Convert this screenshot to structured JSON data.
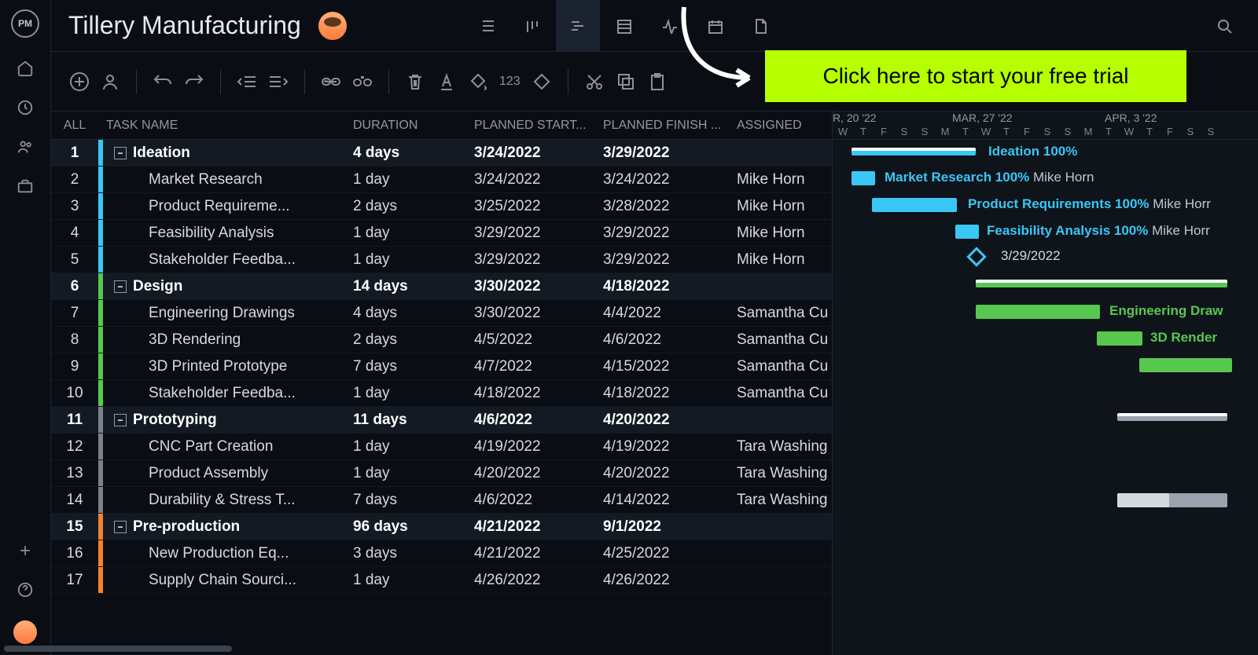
{
  "app": {
    "logo": "PM",
    "project_title": "Tillery Manufacturing"
  },
  "cta": {
    "label": "Click here to start your free trial"
  },
  "columns": {
    "all": "ALL",
    "name": "TASK NAME",
    "duration": "DURATION",
    "start": "PLANNED START...",
    "end": "PLANNED FINISH ...",
    "assigned": "ASSIGNED"
  },
  "toolbar_number": "123",
  "rows": [
    {
      "n": "1",
      "type": "parent",
      "color": "cyan",
      "name": "Ideation",
      "dur": "4 days",
      "s": "3/24/2022",
      "e": "3/29/2022",
      "a": ""
    },
    {
      "n": "2",
      "type": "child",
      "color": "cyan",
      "name": "Market Research",
      "dur": "1 day",
      "s": "3/24/2022",
      "e": "3/24/2022",
      "a": "Mike Horn"
    },
    {
      "n": "3",
      "type": "child",
      "color": "cyan",
      "name": "Product Requireme...",
      "dur": "2 days",
      "s": "3/25/2022",
      "e": "3/28/2022",
      "a": "Mike Horn"
    },
    {
      "n": "4",
      "type": "child",
      "color": "cyan",
      "name": "Feasibility Analysis",
      "dur": "1 day",
      "s": "3/29/2022",
      "e": "3/29/2022",
      "a": "Mike Horn"
    },
    {
      "n": "5",
      "type": "child",
      "color": "cyan",
      "name": "Stakeholder Feedba...",
      "dur": "1 day",
      "s": "3/29/2022",
      "e": "3/29/2022",
      "a": "Mike Horn"
    },
    {
      "n": "6",
      "type": "parent",
      "color": "green",
      "name": "Design",
      "dur": "14 days",
      "s": "3/30/2022",
      "e": "4/18/2022",
      "a": ""
    },
    {
      "n": "7",
      "type": "child",
      "color": "green",
      "name": "Engineering Drawings",
      "dur": "4 days",
      "s": "3/30/2022",
      "e": "4/4/2022",
      "a": "Samantha Cu"
    },
    {
      "n": "8",
      "type": "child",
      "color": "green",
      "name": "3D Rendering",
      "dur": "2 days",
      "s": "4/5/2022",
      "e": "4/6/2022",
      "a": "Samantha Cu"
    },
    {
      "n": "9",
      "type": "child",
      "color": "green",
      "name": "3D Printed Prototype",
      "dur": "7 days",
      "s": "4/7/2022",
      "e": "4/15/2022",
      "a": "Samantha Cu"
    },
    {
      "n": "10",
      "type": "child",
      "color": "green",
      "name": "Stakeholder Feedba...",
      "dur": "1 day",
      "s": "4/18/2022",
      "e": "4/18/2022",
      "a": "Samantha Cu"
    },
    {
      "n": "11",
      "type": "parent",
      "color": "gray",
      "name": "Prototyping",
      "dur": "11 days",
      "s": "4/6/2022",
      "e": "4/20/2022",
      "a": ""
    },
    {
      "n": "12",
      "type": "child",
      "color": "gray",
      "name": "CNC Part Creation",
      "dur": "1 day",
      "s": "4/19/2022",
      "e": "4/19/2022",
      "a": "Tara Washing"
    },
    {
      "n": "13",
      "type": "child",
      "color": "gray",
      "name": "Product Assembly",
      "dur": "1 day",
      "s": "4/20/2022",
      "e": "4/20/2022",
      "a": "Tara Washing"
    },
    {
      "n": "14",
      "type": "child",
      "color": "gray",
      "name": "Durability & Stress T...",
      "dur": "7 days",
      "s": "4/6/2022",
      "e": "4/14/2022",
      "a": "Tara Washing"
    },
    {
      "n": "15",
      "type": "parent",
      "color": "orange",
      "name": "Pre-production",
      "dur": "96 days",
      "s": "4/21/2022",
      "e": "9/1/2022",
      "a": ""
    },
    {
      "n": "16",
      "type": "child",
      "color": "orange",
      "name": "New Production Eq...",
      "dur": "3 days",
      "s": "4/21/2022",
      "e": "4/25/2022",
      "a": ""
    },
    {
      "n": "17",
      "type": "child",
      "color": "orange",
      "name": "Supply Chain Sourci...",
      "dur": "1 day",
      "s": "4/26/2022",
      "e": "4/26/2022",
      "a": ""
    }
  ],
  "timeline": {
    "months": [
      "R, 20 '22",
      "MAR, 27 '22",
      "APR, 3 '22"
    ],
    "days": [
      "W",
      "T",
      "F",
      "S",
      "S",
      "M",
      "T",
      "W",
      "T",
      "F",
      "S",
      "S",
      "M",
      "T",
      "W",
      "T",
      "F",
      "S",
      "S"
    ]
  },
  "gantt_labels": {
    "ideation": "Ideation  100%",
    "market": "Market Research  100%",
    "product": "Product Requirements  100%",
    "feas": "Feasibility Analysis  100%",
    "milestone": "3/29/2022",
    "eng": "Engineering Draw",
    "render": "3D Render",
    "mike": "Mike Horn",
    "mike2": "Mike Horr",
    "mike3": "Mike Horr"
  }
}
